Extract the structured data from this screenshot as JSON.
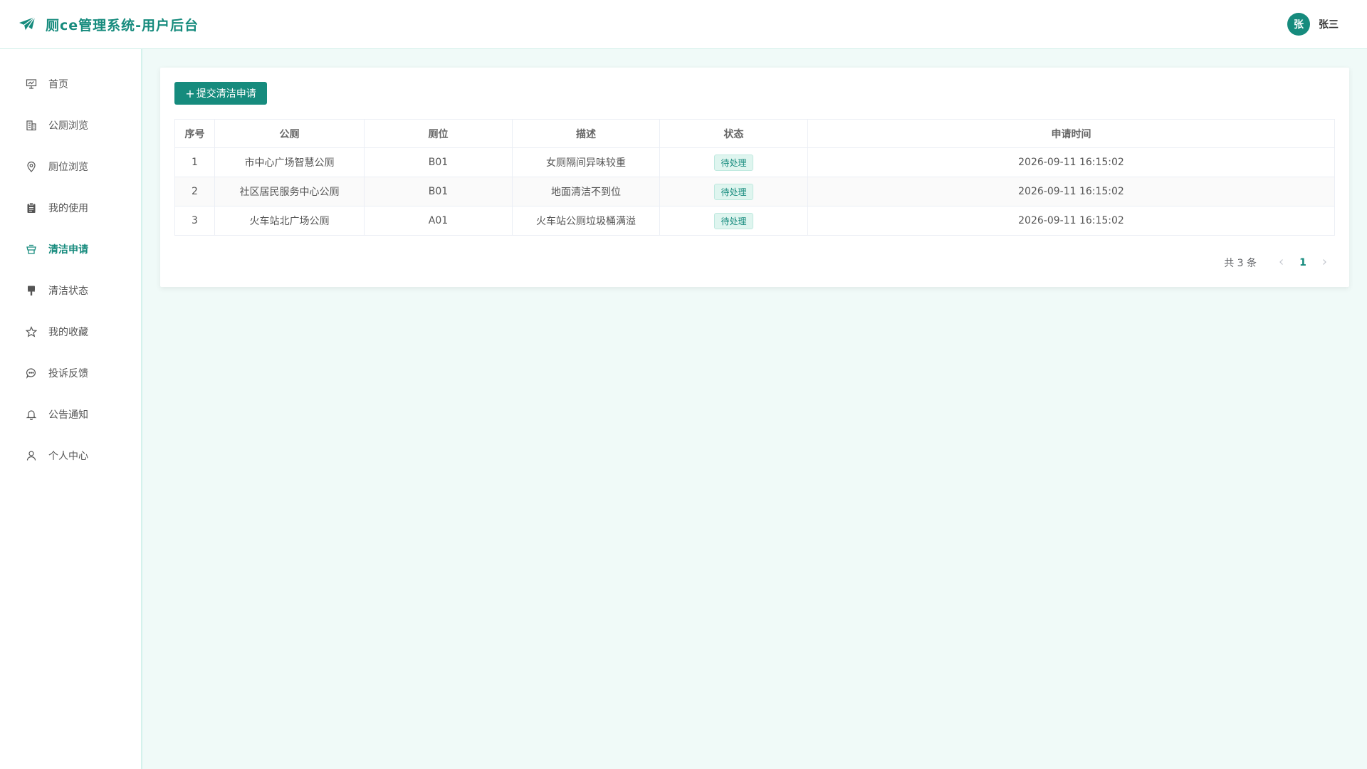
{
  "app": {
    "title": "厕ce管理系统-用户后台",
    "accent_color": "#168b7d"
  },
  "user": {
    "avatar_text": "张",
    "name": "张三"
  },
  "sidebar": {
    "items": [
      {
        "label": "首页",
        "icon": "presentation-icon"
      },
      {
        "label": "公厕浏览",
        "icon": "building-icon"
      },
      {
        "label": "厕位浏览",
        "icon": "location-pin-icon"
      },
      {
        "label": "我的使用",
        "icon": "clipboard-icon"
      },
      {
        "label": "清洁申请",
        "icon": "tray-icon",
        "active": true
      },
      {
        "label": "清洁状态",
        "icon": "brush-icon"
      },
      {
        "label": "我的收藏",
        "icon": "star-icon"
      },
      {
        "label": "投诉反馈",
        "icon": "chat-bubble-icon"
      },
      {
        "label": "公告通知",
        "icon": "bell-icon"
      },
      {
        "label": "个人中心",
        "icon": "user-icon"
      }
    ]
  },
  "main": {
    "submit_button": "提交清洁申请",
    "table": {
      "headers": [
        "序号",
        "公厕",
        "厕位",
        "描述",
        "状态",
        "申请时间"
      ],
      "rows": [
        [
          "1",
          "市中心广场智慧公厕",
          "B01",
          "女厕隔间异味较重",
          "待处理",
          "2026-09-11 16:15:02"
        ],
        [
          "2",
          "社区居民服务中心公厕",
          "B01",
          "地面清洁不到位",
          "待处理",
          "2026-09-11 16:15:02"
        ],
        [
          "3",
          "火车站北广场公厕",
          "A01",
          "火车站公厕垃圾桶满溢",
          "待处理",
          "2026-09-11 16:15:02"
        ]
      ]
    },
    "pagination": {
      "total_text": "共 3 条",
      "current_page": "1",
      "prev_icon": "chevron-left-icon",
      "next_icon": "chevron-right-icon"
    }
  }
}
